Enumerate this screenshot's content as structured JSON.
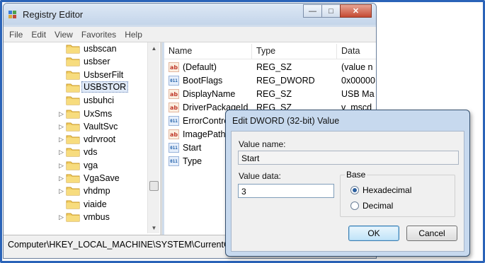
{
  "window": {
    "title": "Registry Editor",
    "controls": {
      "minimize": "—",
      "maximize": "□",
      "close": "✕"
    }
  },
  "menu": [
    "File",
    "Edit",
    "View",
    "Favorites",
    "Help"
  ],
  "tree": {
    "items": [
      {
        "label": "usbscan",
        "expandable": false,
        "selected": false
      },
      {
        "label": "usbser",
        "expandable": false,
        "selected": false
      },
      {
        "label": "UsbserFilt",
        "expandable": false,
        "selected": false
      },
      {
        "label": "USBSTOR",
        "expandable": false,
        "selected": true
      },
      {
        "label": "usbuhci",
        "expandable": false,
        "selected": false
      },
      {
        "label": "UxSms",
        "expandable": true,
        "selected": false
      },
      {
        "label": "VaultSvc",
        "expandable": true,
        "selected": false
      },
      {
        "label": "vdrvroot",
        "expandable": true,
        "selected": false
      },
      {
        "label": "vds",
        "expandable": true,
        "selected": false
      },
      {
        "label": "vga",
        "expandable": true,
        "selected": false
      },
      {
        "label": "VgaSave",
        "expandable": true,
        "selected": false
      },
      {
        "label": "vhdmp",
        "expandable": true,
        "selected": false
      },
      {
        "label": "viaide",
        "expandable": false,
        "selected": false
      },
      {
        "label": "vmbus",
        "expandable": true,
        "selected": false
      }
    ],
    "scroll_up": "▲",
    "scroll_down": "▼"
  },
  "values": {
    "columns": [
      "Name",
      "Type",
      "Data"
    ],
    "rows": [
      {
        "name": "(Default)",
        "type": "REG_SZ",
        "data": "(value n",
        "icon": "string-value-icon"
      },
      {
        "name": "BootFlags",
        "type": "REG_DWORD",
        "data": "0x00000",
        "icon": "dword-value-icon"
      },
      {
        "name": "DisplayName",
        "type": "REG_SZ",
        "data": "USB Ma",
        "icon": "string-value-icon"
      },
      {
        "name": "DriverPackageId",
        "type": "REG_SZ",
        "data": "v_mscd",
        "icon": "string-value-icon"
      },
      {
        "name": "ErrorControl",
        "type": "",
        "data": "",
        "icon": "dword-value-icon"
      },
      {
        "name": "ImagePath",
        "type": "",
        "data": "",
        "icon": "string-value-icon"
      },
      {
        "name": "Start",
        "type": "",
        "data": "",
        "icon": "dword-value-icon"
      },
      {
        "name": "Type",
        "type": "",
        "data": "",
        "icon": "dword-value-icon"
      }
    ],
    "icon_text": {
      "string": "ab",
      "dword": "011"
    }
  },
  "status": {
    "path": "Computer\\HKEY_LOCAL_MACHINE\\SYSTEM\\CurrentCont"
  },
  "dialog": {
    "title": "Edit DWORD (32-bit) Value",
    "value_name_label": "Value name:",
    "value_name": "Start",
    "value_data_label": "Value data:",
    "value_data": "3",
    "base_label": "Base",
    "base_options": [
      {
        "label": "Hexadecimal",
        "checked": true
      },
      {
        "label": "Decimal",
        "checked": false
      }
    ],
    "ok_label": "OK",
    "cancel_label": "Cancel"
  },
  "colors": {
    "frame": "#2a63b8",
    "folder": "#e8c04a",
    "selection": "#dfe9f7"
  }
}
